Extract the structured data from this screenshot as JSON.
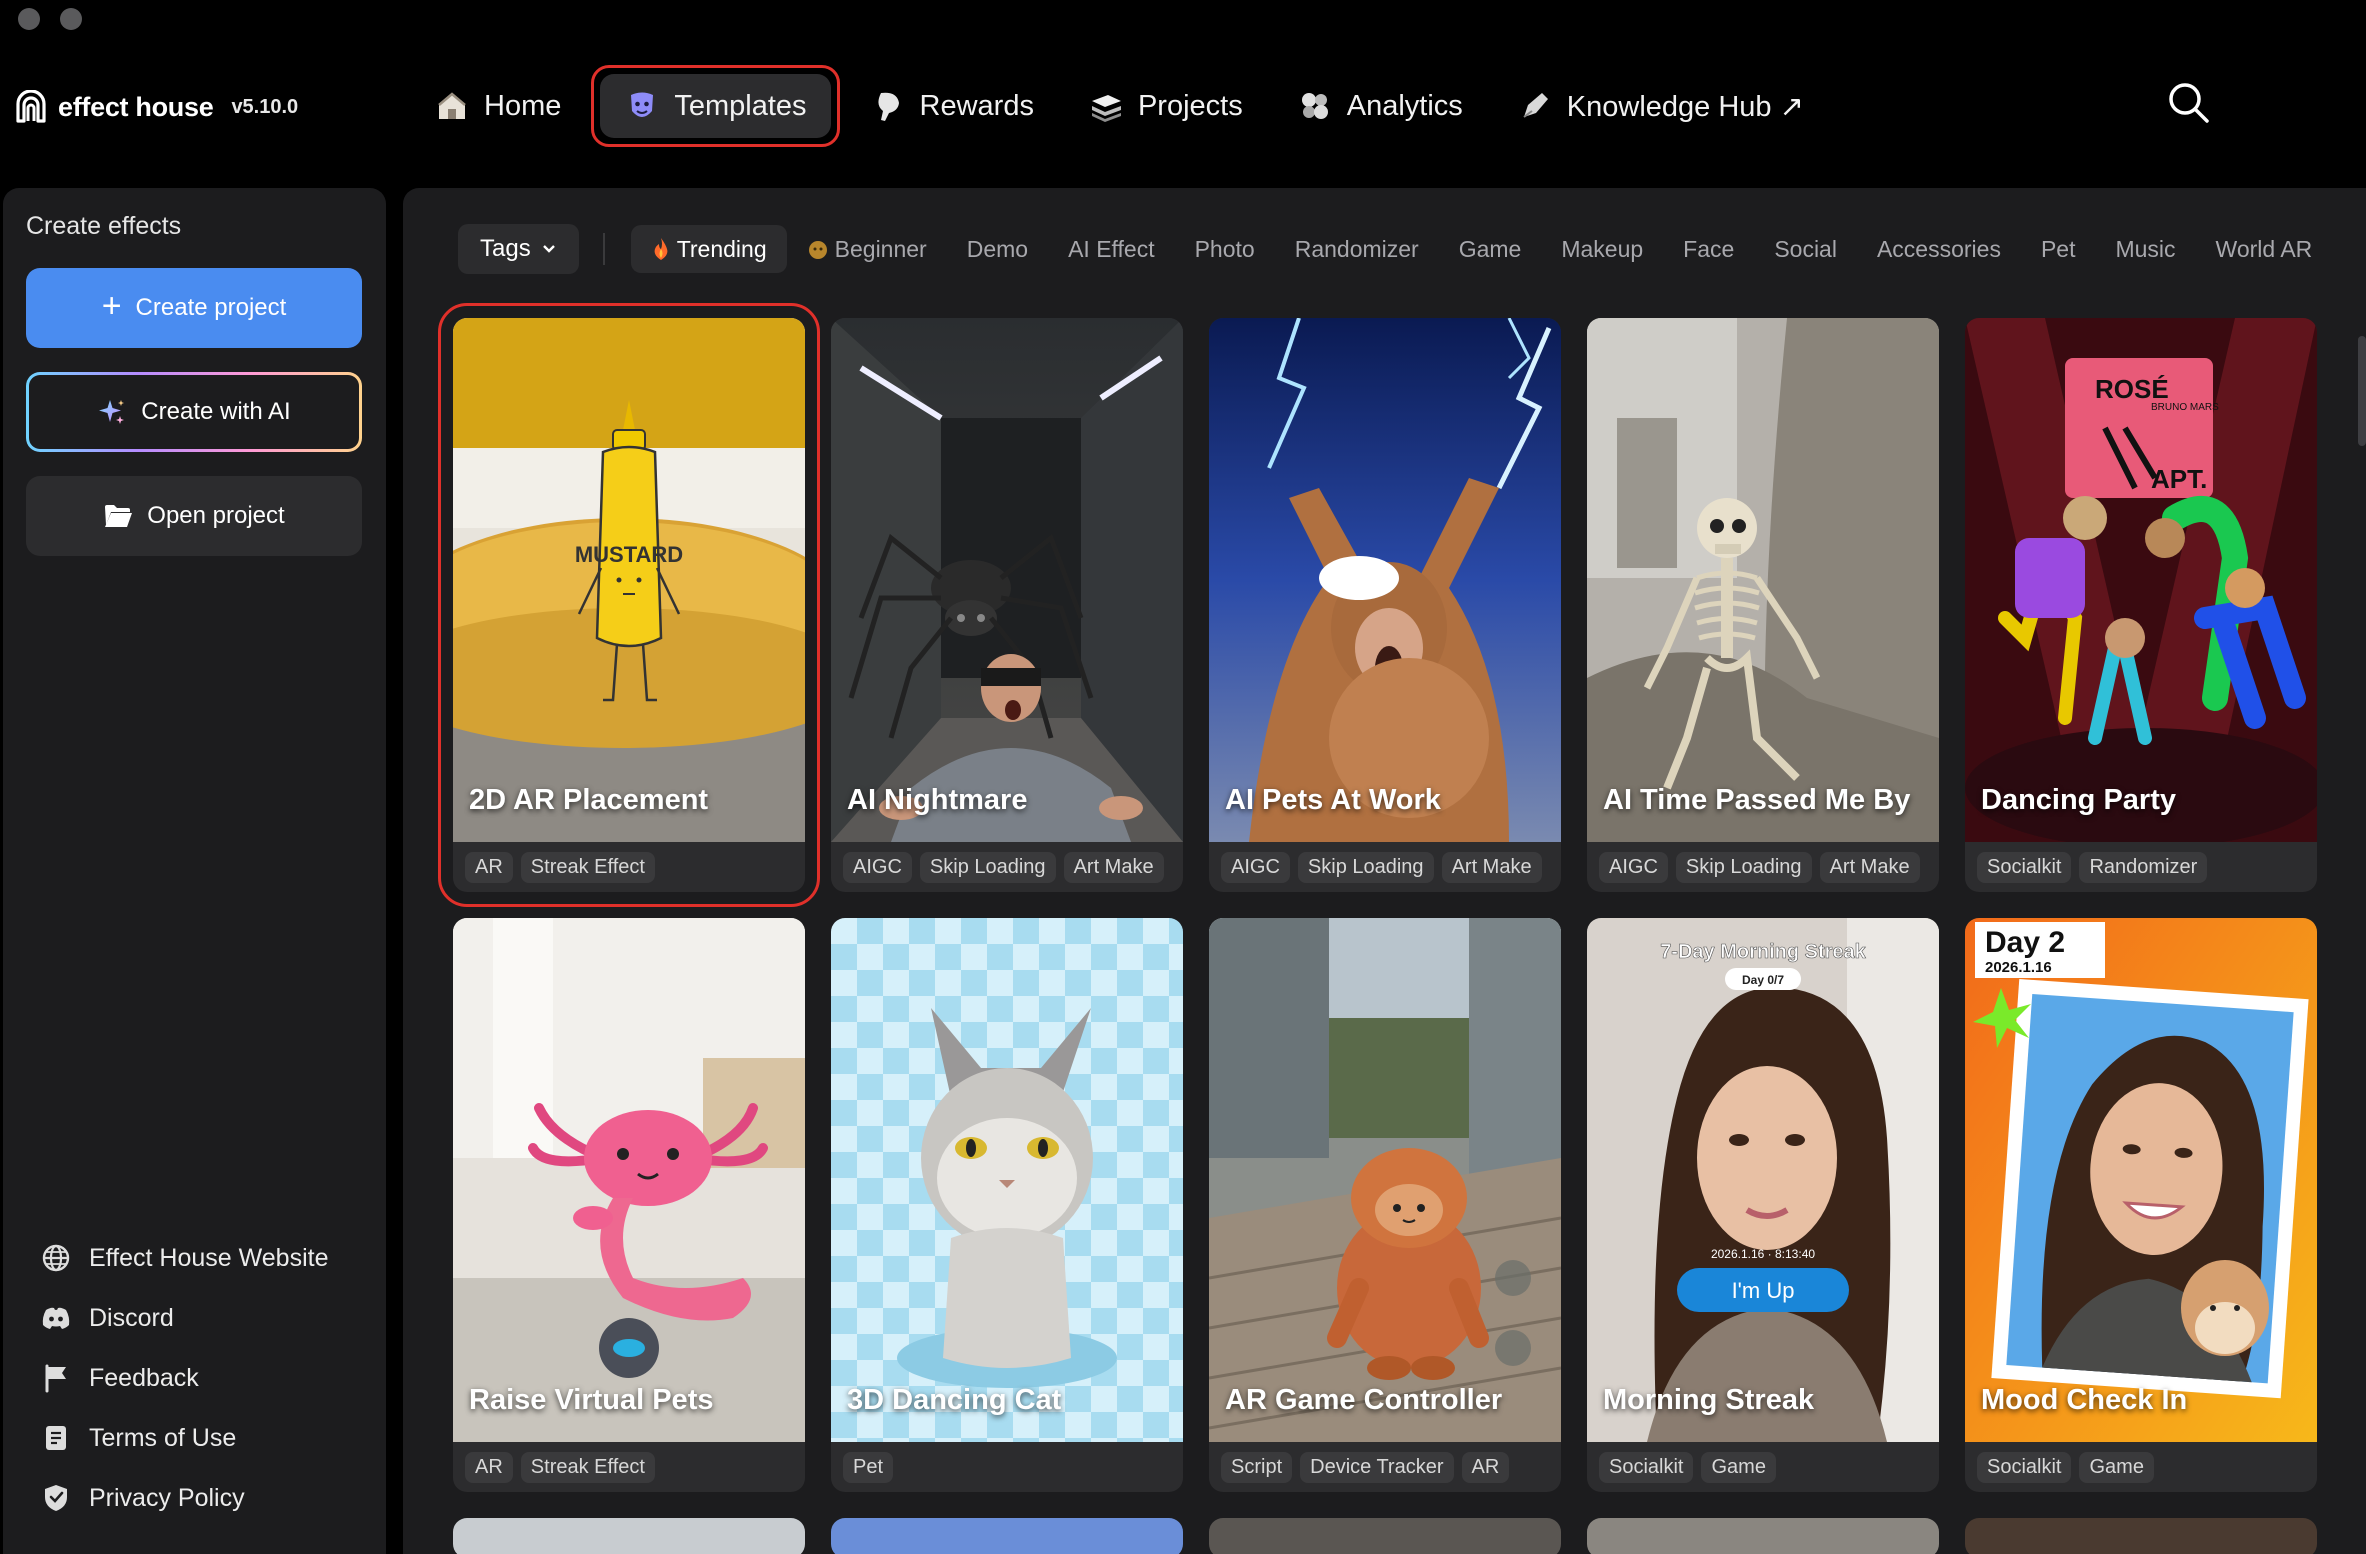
{
  "app": {
    "brand": "effect house",
    "version": "v5.10.0"
  },
  "nav": {
    "items": [
      {
        "label": "Home",
        "icon": "home-icon"
      },
      {
        "label": "Templates",
        "icon": "templates-icon",
        "active": true
      },
      {
        "label": "Rewards",
        "icon": "rewards-icon"
      },
      {
        "label": "Projects",
        "icon": "projects-icon"
      },
      {
        "label": "Analytics",
        "icon": "analytics-icon"
      },
      {
        "label": "Knowledge Hub ↗",
        "icon": "knowledge-hub-icon"
      }
    ]
  },
  "sidebar": {
    "title": "Create effects",
    "create_project": "Create project",
    "create_ai": "Create with AI",
    "open_project": "Open project",
    "links": [
      {
        "label": "Effect House Website",
        "icon": "globe-icon"
      },
      {
        "label": "Discord",
        "icon": "discord-icon"
      },
      {
        "label": "Feedback",
        "icon": "flag-icon"
      },
      {
        "label": "Terms of Use",
        "icon": "document-icon"
      },
      {
        "label": "Privacy Policy",
        "icon": "shield-icon"
      }
    ]
  },
  "filters": {
    "tags_label": "Tags",
    "chips": [
      "Trending",
      "Beginner",
      "Demo",
      "AI Effect",
      "Photo",
      "Randomizer",
      "Game",
      "Makeup",
      "Face",
      "Social",
      "Accessories",
      "Pet",
      "Music",
      "World AR"
    ],
    "active": "Trending"
  },
  "templates": [
    {
      "title": "2D AR Placement",
      "tags": [
        "AR",
        "Streak Effect"
      ],
      "selected": true
    },
    {
      "title": "AI Nightmare",
      "tags": [
        "AIGC",
        "Skip Loading",
        "Art Make"
      ]
    },
    {
      "title": "AI Pets At Work",
      "tags": [
        "AIGC",
        "Skip Loading",
        "Art Make"
      ]
    },
    {
      "title": "AI Time Passed Me By",
      "tags": [
        "AIGC",
        "Skip Loading",
        "Art Make"
      ]
    },
    {
      "title": "Dancing Party",
      "tags": [
        "Socialkit",
        "Randomizer"
      ]
    },
    {
      "title": "Raise Virtual Pets",
      "tags": [
        "AR",
        "Streak Effect"
      ]
    },
    {
      "title": "3D Dancing Cat",
      "tags": [
        "Pet"
      ]
    },
    {
      "title": "AR Game Controller",
      "tags": [
        "Script",
        "Device Tracker",
        "AR"
      ]
    },
    {
      "title": "Morning Streak",
      "tags": [
        "Socialkit",
        "Game"
      ]
    },
    {
      "title": "Mood Check In",
      "tags": [
        "Socialkit",
        "Game"
      ]
    }
  ],
  "thumb_text": {
    "mustard": "MUSTARD",
    "rose": "ROSÉ",
    "bruno": "BRUNO MARS",
    "apt": "APT.",
    "streak_title": "7-Day Morning Streak",
    "streak_day": "Day 0/7",
    "streak_time": "2026.1.16 · 8:13:40",
    "streak_btn": "I'm Up",
    "mood_day": "Day 2",
    "mood_date": "2026.1.16"
  },
  "colors": {
    "accent": "#4a8cf0",
    "selection": "#e0302a",
    "panel": "#1c1c1e"
  }
}
